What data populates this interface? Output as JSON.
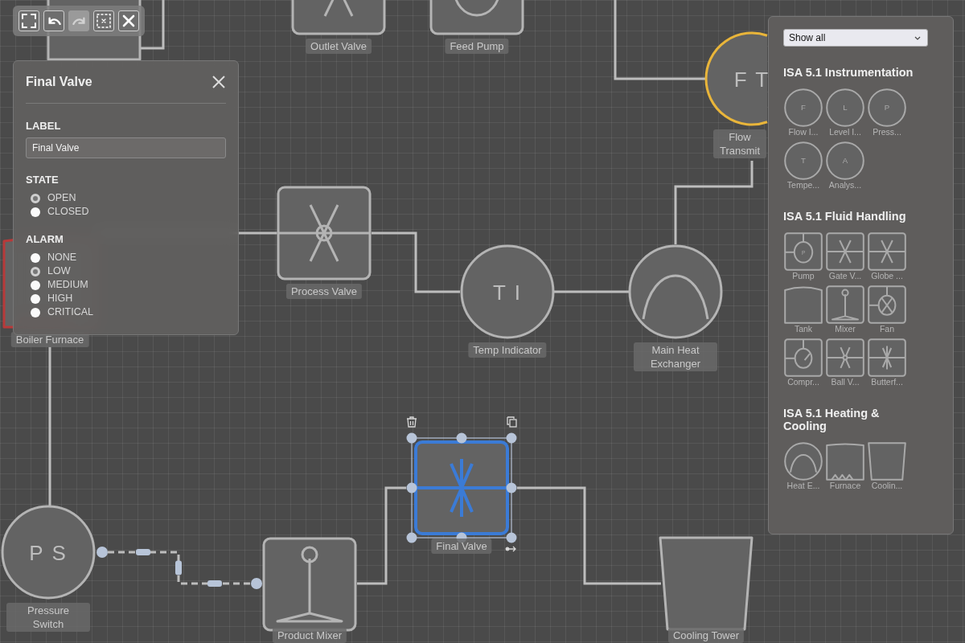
{
  "toolbar": [
    {
      "kind": "fullscreen",
      "disabled": false
    },
    {
      "kind": "undo",
      "disabled": false
    },
    {
      "kind": "redo",
      "disabled": true
    },
    {
      "kind": "clear-selection",
      "disabled": false
    },
    {
      "kind": "close",
      "disabled": false
    }
  ],
  "nodes": [
    {
      "kind": "tank",
      "selected": false
    },
    {
      "kind": "gate-valve",
      "label": "Outlet Valve",
      "selected": false
    },
    {
      "kind": "pump",
      "label": "Feed Pump",
      "selected": false
    },
    {
      "kind": "instrument",
      "tag": "F T",
      "label": "Flow Transmit",
      "color": "#e9b53a",
      "selected": false
    },
    {
      "kind": "globe-valve",
      "label": "Process Valve",
      "selected": false
    },
    {
      "kind": "instrument",
      "tag": "T I",
      "label": "Temp Indicator",
      "selected": false
    },
    {
      "kind": "heat-exchanger",
      "label": "Main Heat Exchanger",
      "selected": false
    },
    {
      "kind": "butterfly-valve",
      "label": "Final Valve",
      "selected": true
    },
    {
      "kind": "instrument",
      "tag": "P S",
      "label": "Pressure Switch",
      "selected": false
    },
    {
      "kind": "mixer",
      "label": "Product Mixer",
      "selected": false
    },
    {
      "kind": "cooling-tower",
      "label": "Cooling Tower",
      "selected": false
    },
    {
      "kind": "furnace",
      "label": "Boiler Furnace",
      "color": "#b83a3a",
      "selected": false
    }
  ],
  "connections": [
    {
      "selected": false
    },
    {
      "selected": false
    },
    {
      "selected": false
    },
    {
      "selected": false
    },
    {
      "selected": false
    },
    {
      "selected": false
    },
    {
      "selected": false
    },
    {
      "selected": true
    },
    {
      "selected": false
    },
    {
      "selected": false
    }
  ],
  "properties_panel": {
    "title": "Final Valve",
    "label_heading": "LABEL",
    "label_value": "Final Valve",
    "state_heading": "STATE",
    "states": [
      {
        "label": "OPEN",
        "selected": true
      },
      {
        "label": "CLOSED",
        "selected": false
      }
    ],
    "alarm_heading": "ALARM",
    "alarms": [
      {
        "label": "NONE",
        "selected": false
      },
      {
        "label": "LOW",
        "selected": true
      },
      {
        "label": "MEDIUM",
        "selected": false
      },
      {
        "label": "HIGH",
        "selected": false
      },
      {
        "label": "CRITICAL",
        "selected": false
      }
    ]
  },
  "palette": {
    "filter": "Show all",
    "sections": [
      {
        "title": "ISA 5.1 Instrumentation",
        "items": [
          {
            "kind": "instrument",
            "letter": "F",
            "label": "Flow I..."
          },
          {
            "kind": "instrument",
            "letter": "L",
            "label": "Level I..."
          },
          {
            "kind": "instrument",
            "letter": "P",
            "label": "Press..."
          },
          {
            "kind": "instrument",
            "letter": "T",
            "label": "Tempe..."
          },
          {
            "kind": "instrument",
            "letter": "A",
            "label": "Analys..."
          }
        ]
      },
      {
        "title": "ISA 5.1 Fluid Handling",
        "items": [
          {
            "kind": "pump",
            "letter": "P",
            "label": "Pump"
          },
          {
            "kind": "gate-valve",
            "label": "Gate V..."
          },
          {
            "kind": "gate-valve",
            "label": "Globe ..."
          },
          {
            "kind": "tank",
            "label": "Tank"
          },
          {
            "kind": "mixer",
            "label": "Mixer"
          },
          {
            "kind": "fan",
            "label": "Fan"
          },
          {
            "kind": "compressor",
            "label": "Compr..."
          },
          {
            "kind": "ball-valve",
            "label": "Ball V..."
          },
          {
            "kind": "butterfly-valve",
            "label": "Butterf..."
          }
        ]
      },
      {
        "title": "ISA 5.1 Heating & Cooling",
        "items": [
          {
            "kind": "heat-exchanger",
            "label": "Heat E..."
          },
          {
            "kind": "furnace",
            "label": "Furnace"
          },
          {
            "kind": "cooling-tower",
            "label": "Coolin..."
          }
        ]
      }
    ]
  }
}
